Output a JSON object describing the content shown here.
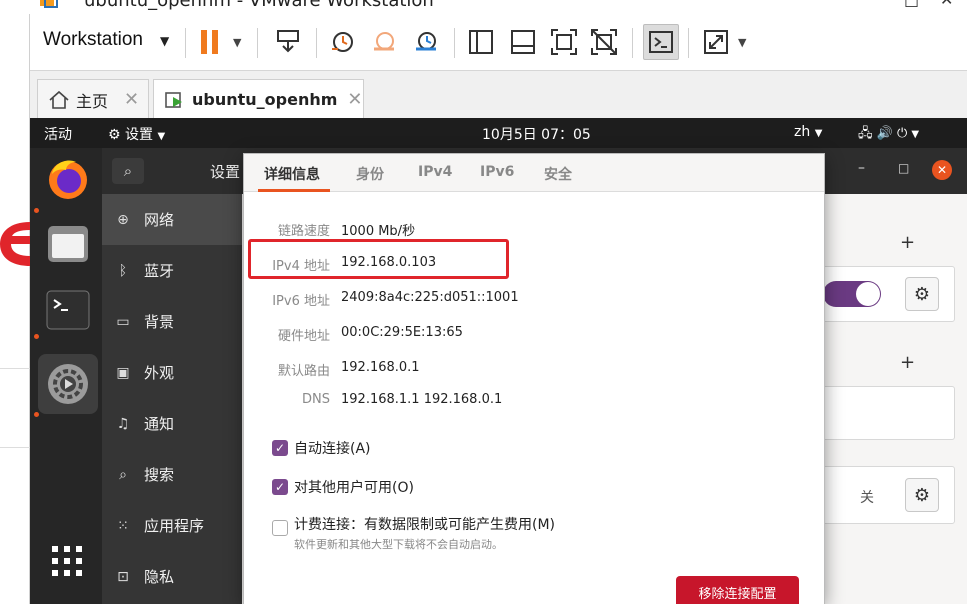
{
  "window": {
    "title": "ubuntu_openhm - VMware Workstation",
    "close_glyph": "✕",
    "restore_glyph": "□"
  },
  "toolbar": {
    "menu_label": "Workstation"
  },
  "tabs": [
    {
      "label": "主页",
      "close": "✕"
    },
    {
      "label": "ubuntu_openhm",
      "close": "✕"
    }
  ],
  "guest_topbar": {
    "activities": "活动",
    "app_menu": "设置",
    "clock": "10月5日  07：05",
    "input_method": "zh"
  },
  "settings": {
    "title": "设置",
    "sidebar": [
      {
        "label": "网络",
        "icon": "network-icon",
        "selected": true
      },
      {
        "label": "蓝牙",
        "icon": "bluetooth-icon"
      },
      {
        "label": "背景",
        "icon": "background-icon"
      },
      {
        "label": "外观",
        "icon": "appearance-icon"
      },
      {
        "label": "通知",
        "icon": "notification-bell-icon"
      },
      {
        "label": "搜索",
        "icon": "search-icon"
      },
      {
        "label": "应用程序",
        "icon": "apps-grid-icon"
      },
      {
        "label": "隐私",
        "icon": "privacy-lock-icon"
      }
    ],
    "right_controls": {
      "add1": "+",
      "add2": "+",
      "off_label": "关"
    }
  },
  "dialog": {
    "tabs": [
      "详细信息",
      "身份",
      "IPv4",
      "IPv6",
      "安全"
    ],
    "active_tab": 0,
    "details": [
      {
        "label": "链路速度",
        "value": "1000 Mb/秒"
      },
      {
        "label": "IPv4 地址",
        "value": "192.168.0.103"
      },
      {
        "label": "IPv6 地址",
        "value": "2409:8a4c:225:d051::1001"
      },
      {
        "label": "硬件地址",
        "value": "00:0C:29:5E:13:65"
      },
      {
        "label": "默认路由",
        "value": "192.168.0.1"
      },
      {
        "label": "DNS",
        "value": "192.168.1.1 192.168.0.1"
      }
    ],
    "options": [
      {
        "label": "自动连接(A)",
        "checked": true
      },
      {
        "label": "对其他用户可用(O)",
        "checked": true
      },
      {
        "label": "计费连接：有数据限制或可能产生费用(M)",
        "checked": false,
        "sub": "软件更新和其他大型下载将不会自动启动。"
      }
    ],
    "remove_button": "移除连接配置"
  },
  "colors": {
    "accent": "#e95420",
    "highlight_box": "#e0252b",
    "check": "#7b4a8e",
    "remove": "#c7162b"
  }
}
